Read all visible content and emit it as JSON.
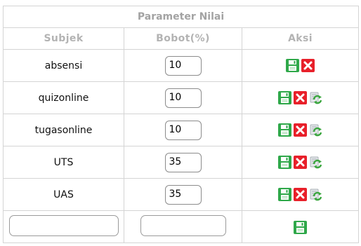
{
  "table": {
    "title": "Parameter Nilai",
    "columns": {
      "subjek": "Subjek",
      "bobot": "Bobot(%)",
      "aksi": "Aksi"
    },
    "rows": [
      {
        "subjek": "absensi",
        "bobot": "10",
        "actions": [
          "save-icon",
          "delete-icon"
        ]
      },
      {
        "subjek": "quizonline",
        "bobot": "10",
        "actions": [
          "save-icon",
          "delete-icon",
          "refresh-icon"
        ]
      },
      {
        "subjek": "tugasonline",
        "bobot": "10",
        "actions": [
          "save-icon",
          "delete-icon",
          "refresh-icon"
        ]
      },
      {
        "subjek": "UTS",
        "bobot": "35",
        "actions": [
          "save-icon",
          "delete-icon",
          "refresh-icon"
        ]
      },
      {
        "subjek": "UAS",
        "bobot": "35",
        "actions": [
          "save-icon",
          "delete-icon",
          "refresh-icon"
        ]
      }
    ],
    "new_row": {
      "subjek_value": "",
      "bobot_value": "",
      "actions": [
        "save-icon"
      ]
    }
  },
  "colors": {
    "border": "#d4d4d4",
    "header_text": "#b3b3b3",
    "save_green": "#2fa84a",
    "delete_red": "#e8202a",
    "refresh_gray": "#a9b0b6",
    "refresh_green": "#3aa63e"
  }
}
